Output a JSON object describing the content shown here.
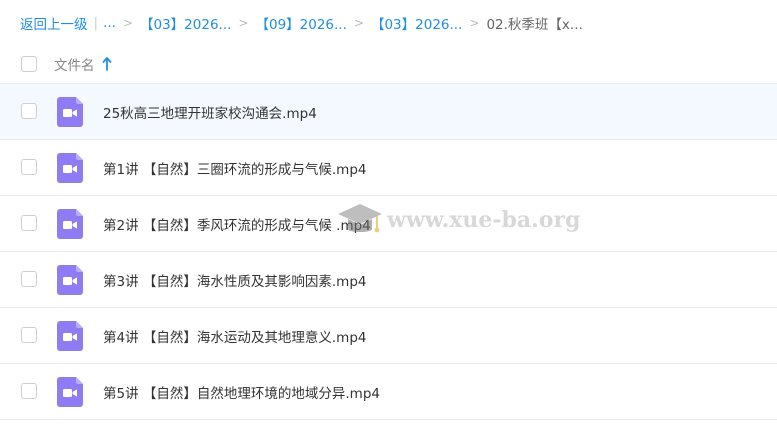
{
  "breadcrumb": {
    "back_label": "返回上一级",
    "ellipsis": "...",
    "items": [
      "【03】2026...",
      "【09】2026...",
      "【03】2026..."
    ],
    "current": "02.秋季班【x..."
  },
  "header": {
    "column_name": "文件名",
    "sort_direction": "ascending"
  },
  "files": [
    {
      "name": "25秋高三地理开班家校沟通会.mp4",
      "type": "video",
      "hovered": true
    },
    {
      "name": "第1讲 【自然】三圈环流的形成与气候.mp4",
      "type": "video"
    },
    {
      "name": "第2讲 【自然】季风环流的形成与气候 .mp4",
      "type": "video"
    },
    {
      "name": "第3讲 【自然】海水性质及其影响因素.mp4",
      "type": "video"
    },
    {
      "name": "第4讲 【自然】海水运动及其地理意义.mp4",
      "type": "video"
    },
    {
      "name": "第5讲 【自然】自然地理环境的地域分异.mp4",
      "type": "video"
    }
  ],
  "watermark": {
    "text": "www.xue-ba.org",
    "icon": "graduation-cap-icon"
  },
  "colors": {
    "accent": "#1f8fe5",
    "video_icon": "#8f7bf2",
    "hover_row": "#f3f9fe"
  }
}
